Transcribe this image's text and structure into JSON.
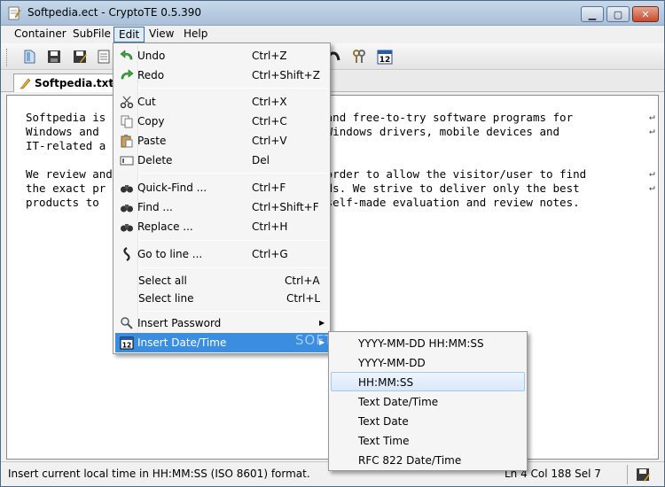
{
  "window": {
    "title": "Softpedia.ect - CryptoTE 0.5.390"
  },
  "menubar": {
    "items": [
      "Container",
      "SubFile",
      "Edit",
      "View",
      "Help"
    ]
  },
  "tab": {
    "label": "Softpedia.txt",
    "close": "×"
  },
  "editor": {
    "lines": [
      "Softpedia is                                 and free-to-try software programs for",
      "Windows and                                  Windows drivers, mobile devices and",
      "IT-related a",
      "",
      "We review and                                order to allow the visitor/user to find",
      "the exact pr                                 ds. We strive to deliver only the best",
      "products to                                  self-made evaluation and review notes."
    ],
    "eol_marker": "↵"
  },
  "edit_menu": {
    "undo": {
      "label": "Undo",
      "shortcut": "Ctrl+Z"
    },
    "redo": {
      "label": "Redo",
      "shortcut": "Ctrl+Shift+Z"
    },
    "cut": {
      "label": "Cut",
      "shortcut": "Ctrl+X"
    },
    "copy": {
      "label": "Copy",
      "shortcut": "Ctrl+C"
    },
    "paste": {
      "label": "Paste",
      "shortcut": "Ctrl+V"
    },
    "delete": {
      "label": "Delete",
      "shortcut": "Del"
    },
    "quick_find": {
      "label": "Quick-Find ...",
      "shortcut": "Ctrl+F"
    },
    "find": {
      "label": "Find ...",
      "shortcut": "Ctrl+Shift+F"
    },
    "replace": {
      "label": "Replace ...",
      "shortcut": "Ctrl+H"
    },
    "goto_line": {
      "label": "Go to line ...",
      "shortcut": "Ctrl+G"
    },
    "select_all": {
      "label": "Select all",
      "shortcut": "Ctrl+A"
    },
    "select_line": {
      "label": "Select line",
      "shortcut": "Ctrl+L"
    },
    "insert_password": {
      "label": "Insert Password"
    },
    "insert_datetime": {
      "label": "Insert Date/Time"
    }
  },
  "datetime_submenu": {
    "items": [
      "YYYY-MM-DD HH:MM:SS",
      "YYYY-MM-DD",
      "HH:MM:SS",
      "Text Date/Time",
      "Text Date",
      "Text Time",
      "RFC 822 Date/Time"
    ],
    "highlighted_index": 2
  },
  "statusbar": {
    "message": "Insert current local time in HH:MM:SS (ISO 8601) format.",
    "position": "Ln 4 Col 188 Sel 7"
  },
  "watermark": "SOFTPEDIA",
  "colors": {
    "menu_highlight": "#3a8ddf",
    "title_gradient_top": "#c9d9ea"
  }
}
